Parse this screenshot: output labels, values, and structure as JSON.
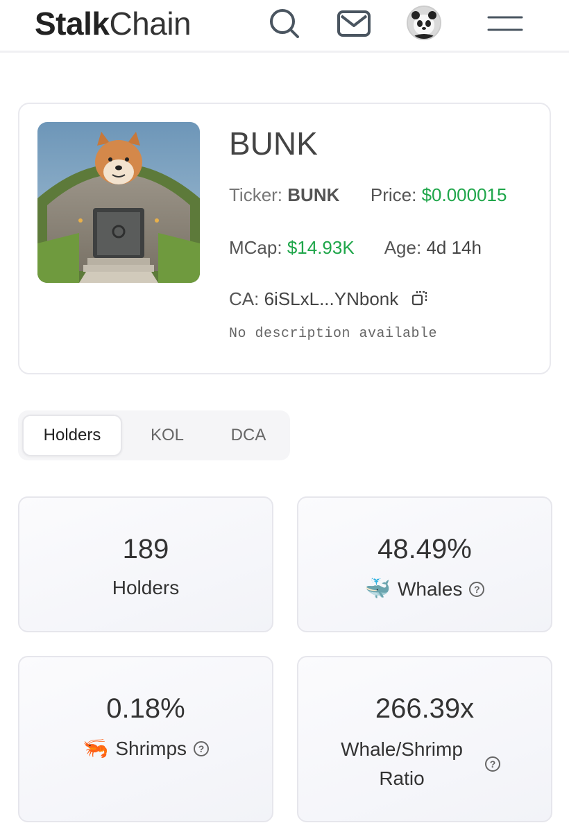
{
  "header": {
    "brand_bold": "Stalk",
    "brand_light": "Chain"
  },
  "token": {
    "name": "BUNK",
    "ticker_label": "Ticker:",
    "ticker": "BUNK",
    "price_label": "Price:",
    "price": "$0.000015",
    "mcap_label": "MCap:",
    "mcap": "$14.93K",
    "age_label": "Age:",
    "age": "4d 14h",
    "ca_label": "CA:",
    "ca": "6iSLxL...YNbonk",
    "description": "No description available"
  },
  "tabs": [
    {
      "label": "Holders",
      "active": true
    },
    {
      "label": "KOL",
      "active": false
    },
    {
      "label": "DCA",
      "active": false
    }
  ],
  "stats": {
    "holders": {
      "value": "189",
      "label": "Holders"
    },
    "whales": {
      "value": "48.49%",
      "label": "Whales",
      "emoji": "🐳"
    },
    "shrimps": {
      "value": "0.18%",
      "label": "Shrimps",
      "emoji": "🦐"
    },
    "ratio": {
      "value": "266.39x",
      "label": "Whale/Shrimp Ratio"
    }
  },
  "help_glyph": "?",
  "colors": {
    "green": "#1fa64a",
    "border": "#e6e6ec"
  }
}
